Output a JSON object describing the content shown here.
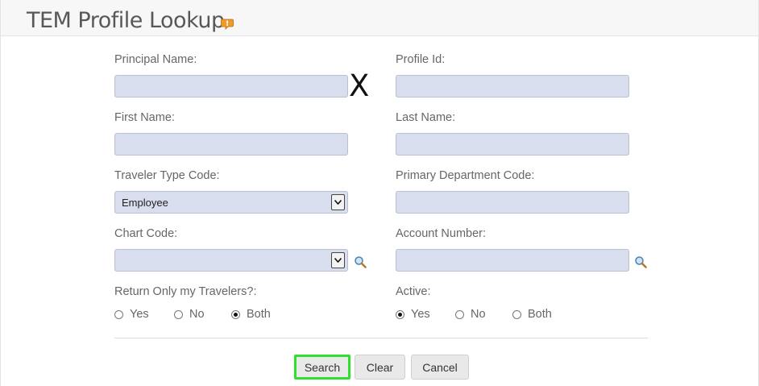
{
  "header": {
    "title": "TEM Profile Lookup",
    "help_icon": "help-speech-bubble-icon"
  },
  "form": {
    "principal_name": {
      "label": "Principal Name:",
      "value": ""
    },
    "profile_id": {
      "label": "Profile Id:",
      "value": ""
    },
    "first_name": {
      "label": "First Name:",
      "value": ""
    },
    "last_name": {
      "label": "Last Name:",
      "value": ""
    },
    "traveler_type_code": {
      "label": "Traveler Type Code:",
      "selected": "Employee"
    },
    "primary_department_code": {
      "label": "Primary Department Code:",
      "value": ""
    },
    "chart_code": {
      "label": "Chart Code:",
      "selected": ""
    },
    "account_number": {
      "label": "Account Number:",
      "value": ""
    },
    "return_only_my_travelers": {
      "label": "Return Only my Travelers?:",
      "options": [
        "Yes",
        "No",
        "Both"
      ],
      "selected": "Both"
    },
    "active": {
      "label": "Active:",
      "options": [
        "Yes",
        "No",
        "Both"
      ],
      "selected": "Yes"
    },
    "overlay_mark": "X"
  },
  "buttons": {
    "search": "Search",
    "clear": "Clear",
    "cancel": "Cancel"
  },
  "colors": {
    "field_bg": "#d8deee",
    "focus_highlight": "#2fe02f"
  }
}
